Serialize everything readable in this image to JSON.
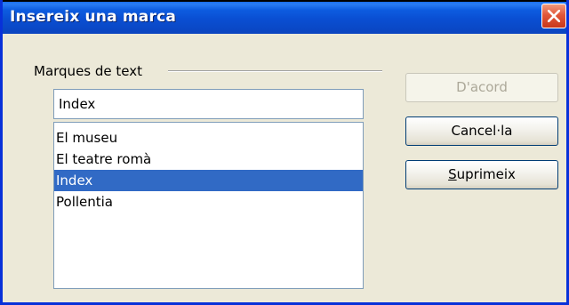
{
  "window": {
    "title": "Insereix una marca"
  },
  "group": {
    "label": "Marques de text"
  },
  "name_input": {
    "value": "Index"
  },
  "list": {
    "items": [
      "El museu",
      "El teatre romà",
      "Index",
      "Pollentia"
    ],
    "selected_index": 2
  },
  "buttons": {
    "ok_label": "D'acord",
    "cancel_label": "Cancel·la",
    "delete_first_letter": "S",
    "delete_rest": "uprimeix"
  },
  "colors": {
    "title_bar": "#0a4fd3",
    "selection": "#316ac5",
    "close_button": "#e2573a",
    "dialog_bg": "#ece9d8"
  },
  "icons": {
    "close": "close-icon"
  }
}
